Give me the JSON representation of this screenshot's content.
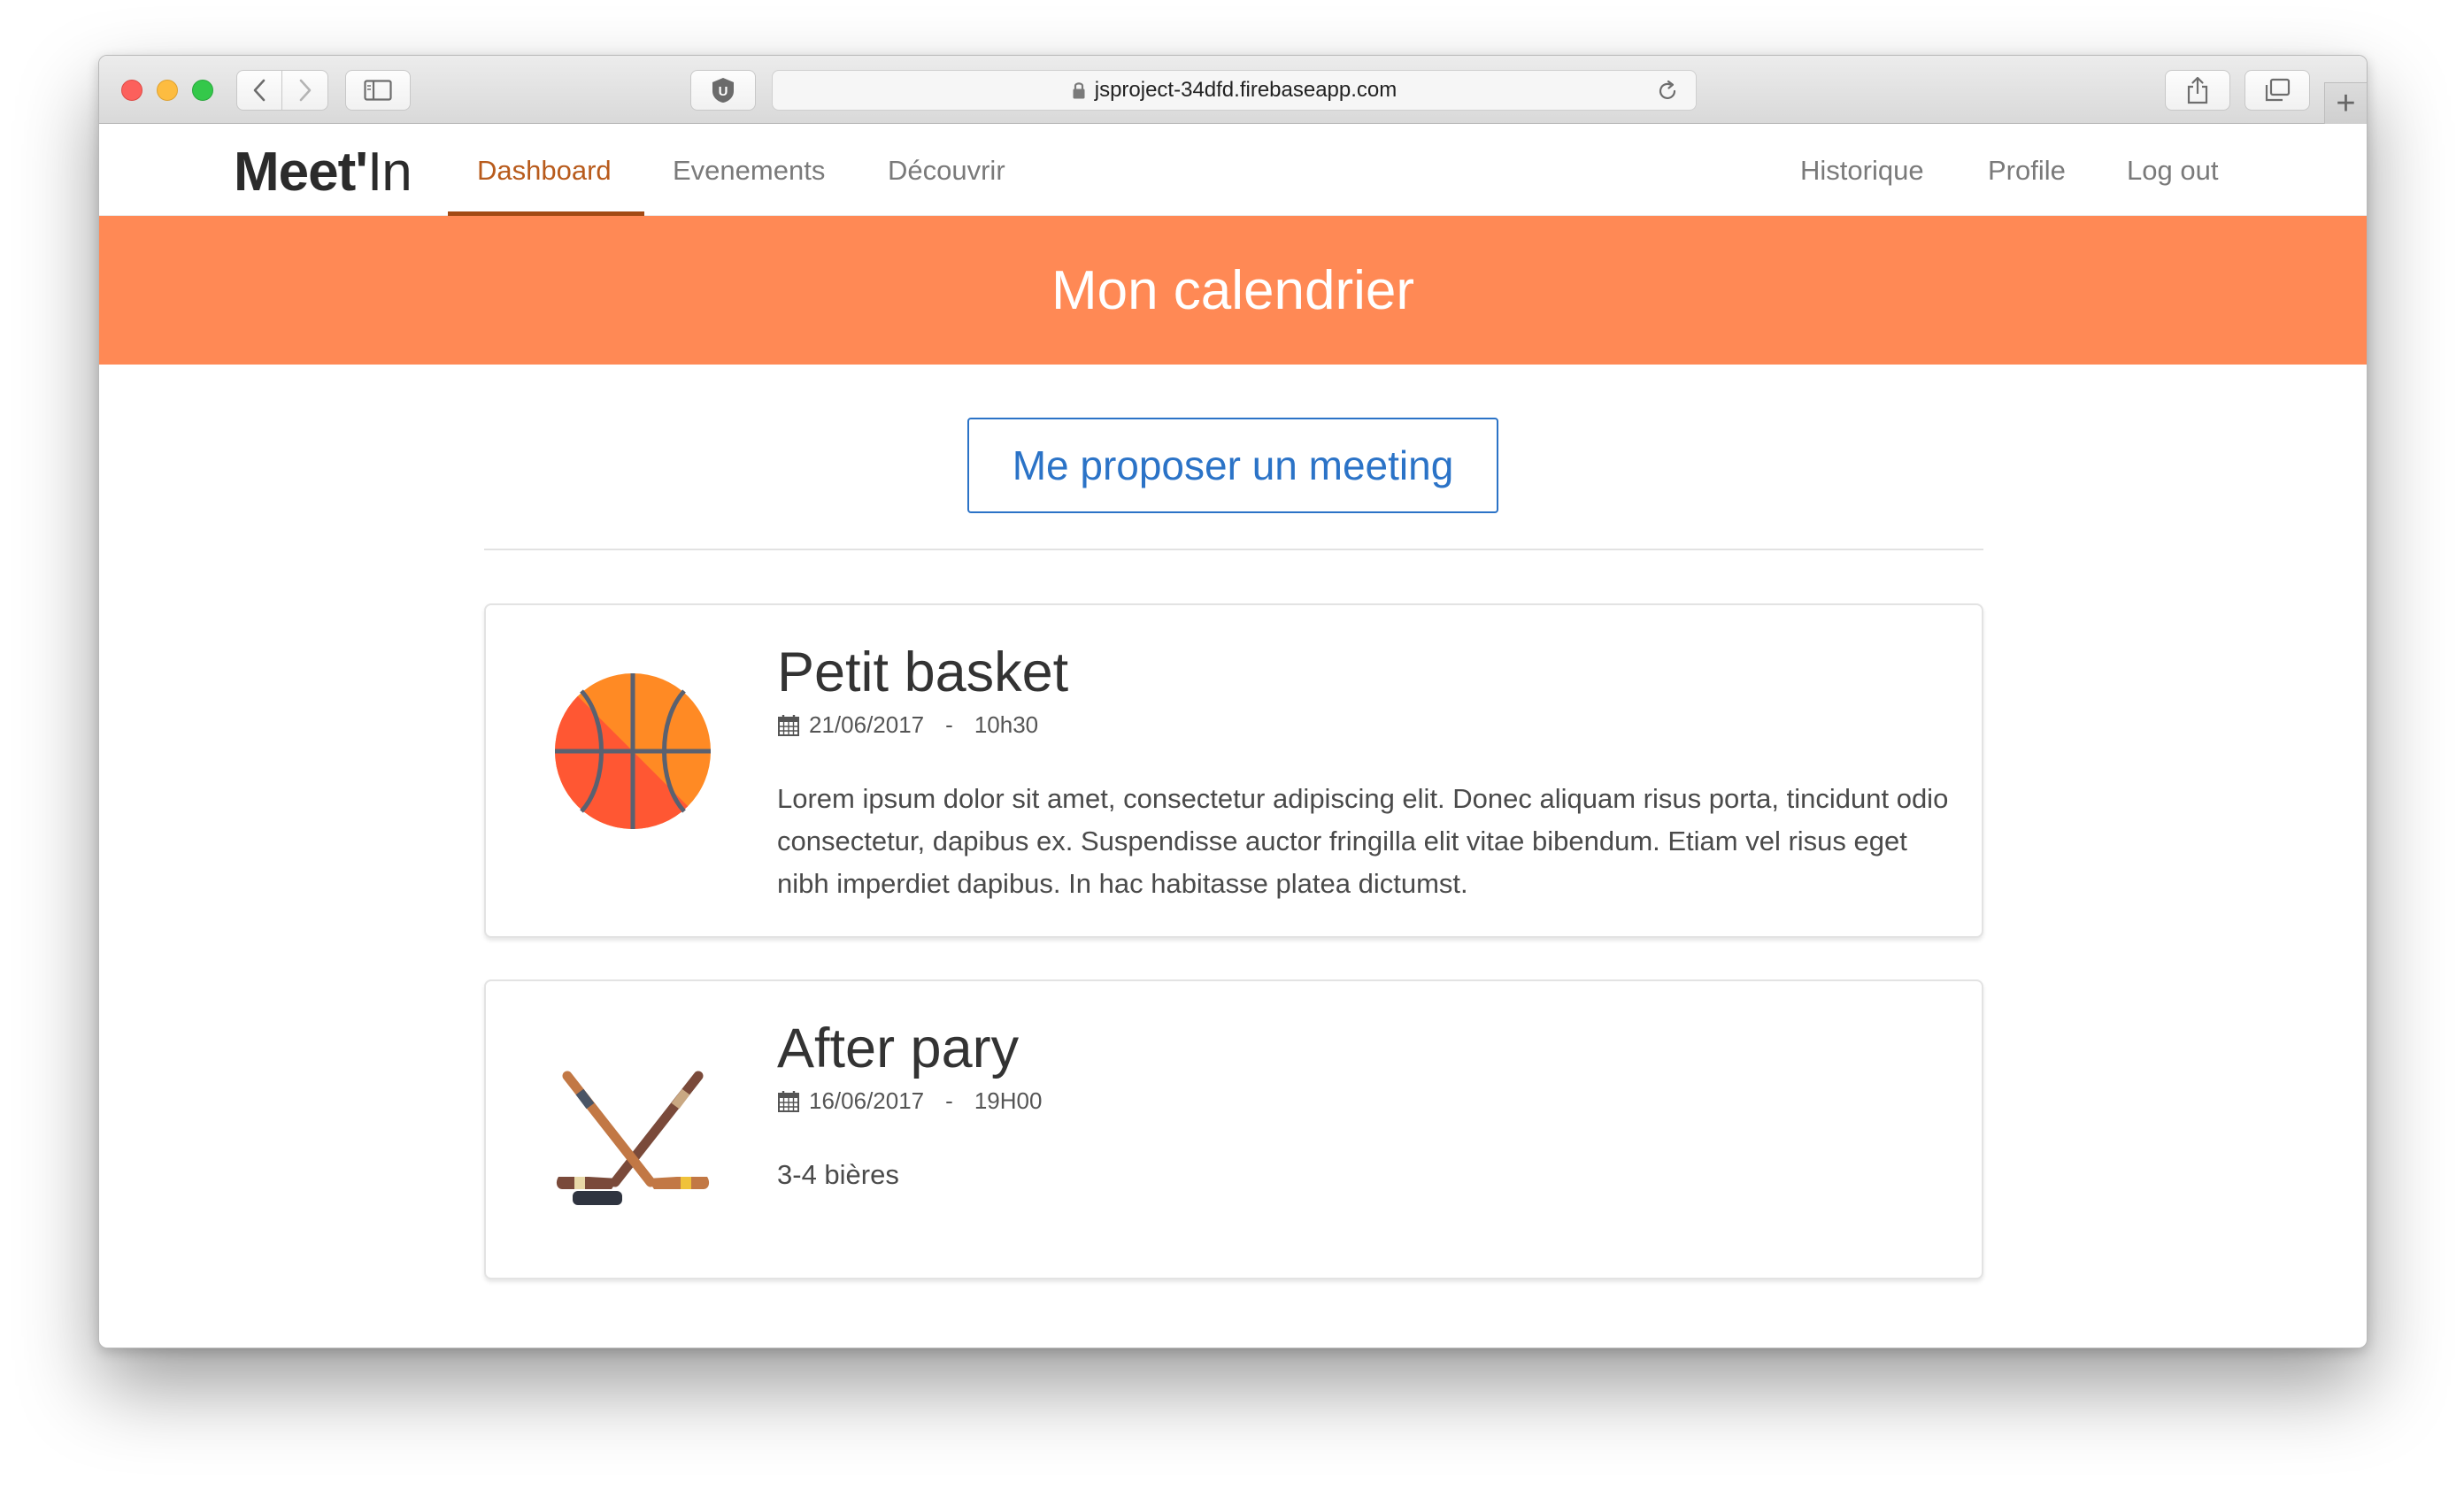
{
  "browser": {
    "url": "jsproject-34dfd.firebaseapp.com",
    "extension_letter": "U"
  },
  "nav": {
    "brand_bold": "Meet'",
    "brand_light": "In",
    "left_links": [
      "Dashboard",
      "Evenements",
      "Découvrir"
    ],
    "right_links": [
      "Historique",
      "Profile",
      "Log out"
    ],
    "active": "Dashboard"
  },
  "hero": {
    "title": "Mon calendrier",
    "color": "#ff8955"
  },
  "cta": {
    "label": "Me proposer un meeting",
    "color": "#2b73c7"
  },
  "events": [
    {
      "title": "Petit basket",
      "date": "21/06/2017",
      "time": "10h30",
      "separator": "-",
      "description": "Lorem ipsum dolor sit amet, consectetur adipiscing elit. Donec aliquam risus porta, tincidunt odio consectetur, dapibus ex. Suspendisse auctor fringilla elit vitae bibendum. Etiam vel risus eget nibh imperdiet dapibus. In hac habitasse platea dictumst.",
      "icon": "basketball-icon"
    },
    {
      "title": "After pary",
      "date": "16/06/2017",
      "time": "19H00",
      "separator": "-",
      "description": "3-4 bières",
      "icon": "hockey-sticks-icon"
    }
  ]
}
